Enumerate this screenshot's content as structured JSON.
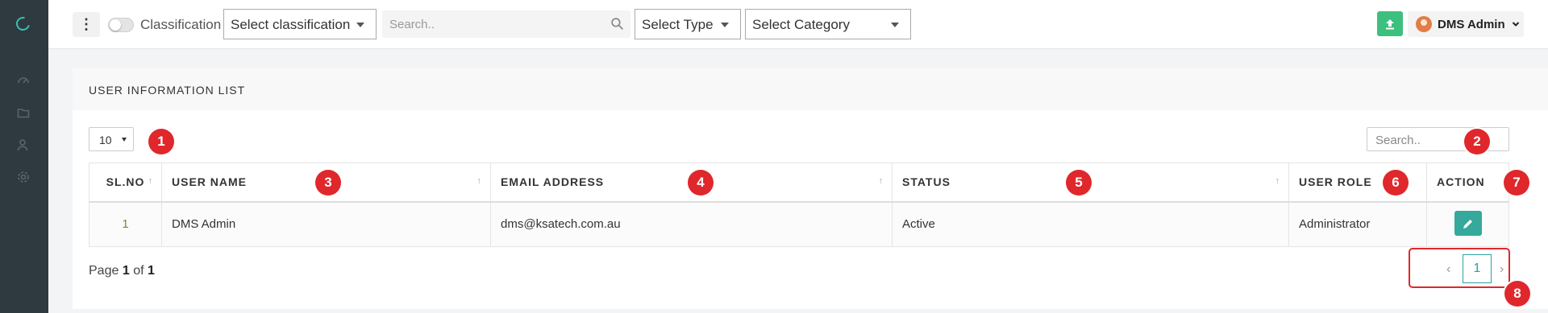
{
  "sidebar": {
    "icons": [
      "logo-icon",
      "dashboard-icon",
      "folder-icon",
      "users-icon",
      "settings-icon"
    ]
  },
  "topbar": {
    "classification_label": "Classification",
    "classification_select": "Select classification",
    "search_placeholder": "Search..",
    "type_select": "Select Type",
    "category_select": "Select Category",
    "user_name": "DMS Admin"
  },
  "panel": {
    "title": "USER INFORMATION LIST",
    "page_length": "10",
    "search_placeholder": "Search..",
    "columns": [
      "SL.NO",
      "USER NAME",
      "EMAIL ADDRESS",
      "STATUS",
      "USER ROLE",
      "ACTION"
    ],
    "rows": [
      {
        "sl_no": "1",
        "user_name": "DMS Admin",
        "email": "dms@ksatech.com.au",
        "status": "Active",
        "role": "Administrator"
      }
    ],
    "page_info": {
      "prefix": "Page",
      "current": "1",
      "mid": "of",
      "total": "1"
    },
    "pager": {
      "prev": "‹",
      "page": "1",
      "next": "›"
    }
  },
  "annotations": [
    "1",
    "2",
    "3",
    "4",
    "5",
    "6",
    "7",
    "8"
  ],
  "colors": {
    "accent": "#35a99b",
    "upload": "#3cc07d",
    "annotation": "#e0272b",
    "sidebar": "#2f3a40"
  }
}
